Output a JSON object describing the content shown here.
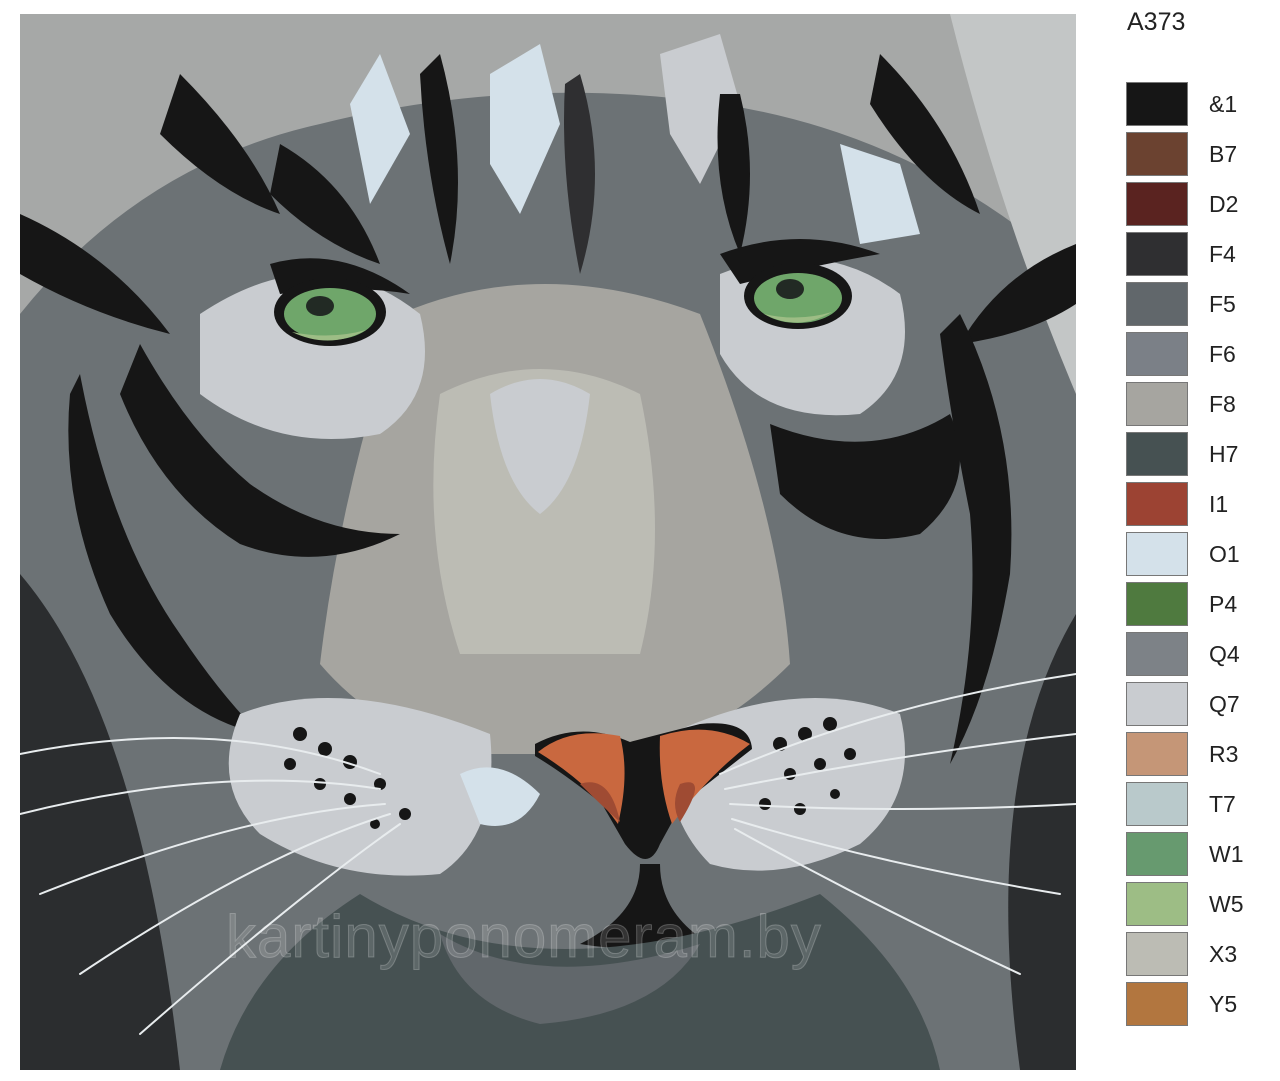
{
  "kit": {
    "code": "A373"
  },
  "artwork": {
    "subject": "white-tiger-face",
    "colors": {
      "iris": "#6fa66a",
      "pupil": "#222a24",
      "nose_top": "#c9683f",
      "nose_mid": "#9f4b33"
    }
  },
  "watermark": {
    "text": "kartinyponomeram.by"
  },
  "palette": [
    {
      "code": "&1",
      "color": "#161616"
    },
    {
      "code": "B7",
      "color": "#6b4230"
    },
    {
      "code": "D2",
      "color": "#5a2320"
    },
    {
      "code": "F4",
      "color": "#2f2f31"
    },
    {
      "code": "F5",
      "color": "#61676b"
    },
    {
      "code": "F6",
      "color": "#7b8087"
    },
    {
      "code": "F8",
      "color": "#a6a5a0"
    },
    {
      "code": "H7",
      "color": "#465152"
    },
    {
      "code": "I1",
      "color": "#9c4333"
    },
    {
      "code": "O1",
      "color": "#d4e1ea"
    },
    {
      "code": "P4",
      "color": "#4f7a3f"
    },
    {
      "code": "Q4",
      "color": "#7d8287"
    },
    {
      "code": "Q7",
      "color": "#c9ccd0"
    },
    {
      "code": "R3",
      "color": "#c59677"
    },
    {
      "code": "T7",
      "color": "#b9c9cb"
    },
    {
      "code": "W1",
      "color": "#679a6f"
    },
    {
      "code": "W5",
      "color": "#9dbd85"
    },
    {
      "code": "X3",
      "color": "#bcbcb4"
    },
    {
      "code": "Y5",
      "color": "#b2763f"
    }
  ]
}
